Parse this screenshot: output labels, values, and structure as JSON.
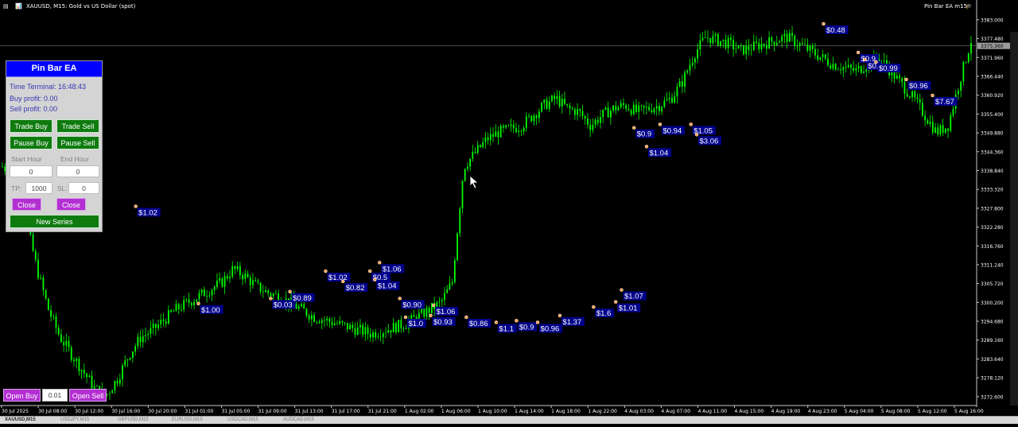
{
  "header": {
    "symbol_text": "XAUUSD, M15:  Gold vs US Dollar (spot)",
    "ea_label": "Pin Bar EA m15"
  },
  "panel": {
    "title": "Pin Bar EA",
    "time_terminal": "Time Terminal: 16:48:43",
    "buy_profit": "Buy profit: 0.00",
    "sell_profit": "Sell profit: 0.00",
    "trade_buy": "Trade Buy",
    "trade_sell": "Trade Sell",
    "pause_buy": "Pause Buy",
    "pause_sell": "Pause Sell",
    "start_hour_label": "Start Hour",
    "end_hour_label": "End Hour",
    "start_hour_value": "0",
    "end_hour_value": "0",
    "tp_label": "TP:",
    "tp_value": "1000",
    "sl_label": "SL:",
    "sl_value": "0",
    "close_buy": "Close",
    "close_sell": "Close",
    "new_series": "New Series"
  },
  "bottom": {
    "open_buy": "Open Buy",
    "lot": "0.01",
    "open_sell": "Open Sell"
  },
  "tabs": [
    "XAUUSD,M15",
    "USDJPY,M15",
    "GBPUSD,M15",
    "EURUSD,M15",
    "USDCAD,M15",
    "AUDCAD,M15"
  ],
  "colors": {
    "candles": "#00ff00",
    "label_bg": "#00008b",
    "panel_title": "#0000ff",
    "buttons_green": "#0f7b0f",
    "buttons_purple": "#b32fd2"
  },
  "chart_data": {
    "type": "candlestick",
    "price_axis": [
      "3383.000",
      "3377.480",
      "3371.960",
      "3366.440",
      "3360.920",
      "3355.400",
      "3349.880",
      "3344.360",
      "3338.840",
      "3333.320",
      "3327.800",
      "3322.280",
      "3316.760",
      "3311.240",
      "3305.720",
      "3300.200",
      "3294.680",
      "3289.160",
      "3283.640",
      "3278.120",
      "3272.600"
    ],
    "current_price": "3375.360",
    "ylim": [
      3270,
      3386
    ],
    "time_axis": [
      "30 Jul 2025",
      "30 Jul 08:00",
      "30 Jul 12:00",
      "30 Jul 16:00",
      "30 Jul 20:00",
      "31 Jul 01:00",
      "31 Jul 05:00",
      "31 Jul 09:00",
      "31 Jul 13:00",
      "31 Jul 17:00",
      "31 Jul 21:00",
      "1 Aug 02:00",
      "1 Aug 06:00",
      "1 Aug 10:00",
      "1 Aug 14:00",
      "1 Aug 18:00",
      "1 Aug 22:00",
      "4 Aug 03:00",
      "4 Aug 07:00",
      "4 Aug 11:00",
      "4 Aug 15:00",
      "4 Aug 19:00",
      "4 Aug 23:00",
      "5 Aug 04:00",
      "5 Aug 08:00",
      "5 Aug 12:00",
      "5 Aug 16:00"
    ],
    "price_path": [
      3340,
      3338,
      3325,
      3310,
      3298,
      3290,
      3285,
      3280,
      3275,
      3273,
      3278,
      3285,
      3290,
      3292,
      3295,
      3298,
      3300,
      3302,
      3304,
      3306,
      3310,
      3308,
      3305,
      3303,
      3302,
      3300,
      3298,
      3296,
      3295,
      3294,
      3293,
      3292,
      3291,
      3292,
      3293,
      3294,
      3296,
      3298,
      3300,
      3306,
      3340,
      3344,
      3348,
      3350,
      3351,
      3352,
      3355,
      3358,
      3360,
      3357,
      3356,
      3352,
      3355,
      3357,
      3358,
      3356,
      3357,
      3358,
      3360,
      3365,
      3373,
      3378,
      3377,
      3376,
      3374,
      3375,
      3376,
      3377,
      3378,
      3376,
      3374,
      3372,
      3370,
      3369,
      3368,
      3370,
      3372,
      3368,
      3364,
      3360,
      3355,
      3350,
      3352,
      3365,
      3377
    ],
    "trade_labels": [
      {
        "text": "$1.00",
        "t": 0.05,
        "p": 3327.5
      },
      {
        "text": "$1.01",
        "t": 0.07,
        "p": 3325.5
      },
      {
        "text": "$1.02",
        "t": 0.14,
        "p": 3326.5
      },
      {
        "text": "$1.00",
        "t": 0.205,
        "p": 3298.0
      },
      {
        "text": "$0.03",
        "t": 0.28,
        "p": 3299.5
      },
      {
        "text": "$0.89",
        "t": 0.3,
        "p": 3301.5
      },
      {
        "text": "$1.02",
        "t": 0.337,
        "p": 3307.5
      },
      {
        "text": "$0.82",
        "t": 0.355,
        "p": 3304.5
      },
      {
        "text": "$0.5",
        "t": 0.383,
        "p": 3307.5
      },
      {
        "text": "$1.06",
        "t": 0.393,
        "p": 3310.0
      },
      {
        "text": "$1.04",
        "t": 0.388,
        "p": 3305.0
      },
      {
        "text": "$0.90",
        "t": 0.414,
        "p": 3299.5
      },
      {
        "text": "$1.06",
        "t": 0.449,
        "p": 3297.5
      },
      {
        "text": "$0.93",
        "t": 0.446,
        "p": 3294.5
      },
      {
        "text": "$1.0",
        "t": 0.42,
        "p": 3294.0
      },
      {
        "text": "$0.86",
        "t": 0.483,
        "p": 3294.0
      },
      {
        "text": "$1.1",
        "t": 0.514,
        "p": 3292.5
      },
      {
        "text": "$0.9",
        "t": 0.535,
        "p": 3293.0
      },
      {
        "text": "$0.96",
        "t": 0.557,
        "p": 3292.5
      },
      {
        "text": "$1.37",
        "t": 0.58,
        "p": 3294.5
      },
      {
        "text": "$1.6",
        "t": 0.615,
        "p": 3297.0
      },
      {
        "text": "$1.01",
        "t": 0.638,
        "p": 3298.5
      },
      {
        "text": "$1.07",
        "t": 0.644,
        "p": 3302.0
      },
      {
        "text": "$0.9",
        "t": 0.657,
        "p": 3349.5
      },
      {
        "text": "$0.94",
        "t": 0.684,
        "p": 3350.5
      },
      {
        "text": "$1.04",
        "t": 0.67,
        "p": 3344.0
      },
      {
        "text": "$1.05",
        "t": 0.716,
        "p": 3350.5
      },
      {
        "text": "$3.06",
        "t": 0.722,
        "p": 3347.5
      },
      {
        "text": "$1.",
        "t": 0.742,
        "p": 3357.5
      },
      {
        "text": "$3.06",
        "t": 0.765,
        "p": 3356.5
      },
      {
        "text": "$1.00",
        "t": 0.804,
        "p": 3353.5
      },
      {
        "text": "$1.",
        "t": 0.812,
        "p": 3357.5
      },
      {
        "text": "$.02",
        "t": 0.835,
        "p": 3357.0
      },
      {
        "text": "$3.6",
        "t": 0.86,
        "p": 3356.5
      },
      {
        "text": "$0.94",
        "t": 0.885,
        "p": 3356.5
      },
      {
        "text": "$0.82",
        "t": 0.915,
        "p": 3366.5
      },
      {
        "text": "$0.94",
        "t": 0.95,
        "p": 3372.5
      },
      {
        "text": "$2.99",
        "t": 1.04,
        "p": 3370.5
      }
    ],
    "trade_labels_right": [
      {
        "text": "$0.48",
        "x": 1052,
        "y": 38
      },
      {
        "text": "$0.9",
        "x": 1093,
        "y": 74
      },
      {
        "text": "$0.",
        "x": 1099,
        "y": 83
      },
      {
        "text": "$0.99",
        "x": 1118,
        "y": 86
      },
      {
        "text": "$0.96",
        "x": 1156,
        "y": 108
      },
      {
        "text": "$7.67",
        "x": 1189,
        "y": 128
      }
    ]
  }
}
